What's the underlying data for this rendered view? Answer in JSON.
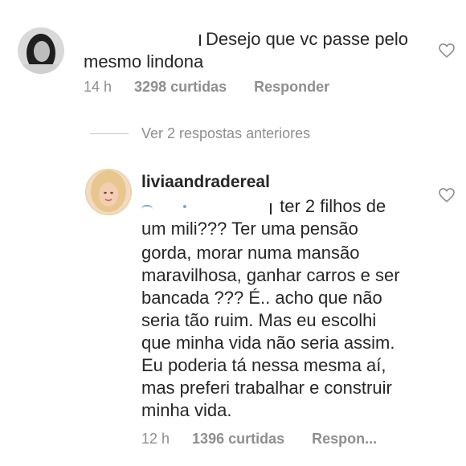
{
  "comment1": {
    "text_line1": "Desejo que vc passe pelo",
    "text_line2": "mesmo lindona",
    "time": "14 h",
    "likes": "3298 curtidas",
    "reply": "Responder"
  },
  "view_replies": "Ver 2 respostas anteriores",
  "comment2": {
    "username": "liviaandradereal",
    "lines": [
      "ter 2 filhos de",
      "um mili??? Ter uma pensão",
      "gorda, morar numa mansão",
      "maravilhosa, ganhar carros e ser",
      "bancada ??? É.. acho que não",
      "seria tão ruim. Mas eu escolhi",
      "que minha vida não seria assim.",
      "Eu poderia tá nessa mesma aí,",
      "mas preferi trabalhar e construir",
      "minha vida."
    ],
    "time": "12 h",
    "likes": "1396 curtidas",
    "reply": "Respon..."
  },
  "colors": {
    "text": "#262626",
    "secondary": "#8e8e8e",
    "mention": "#2f6fb0"
  },
  "icons": [
    "heart-icon",
    "avatar-user-icon"
  ]
}
